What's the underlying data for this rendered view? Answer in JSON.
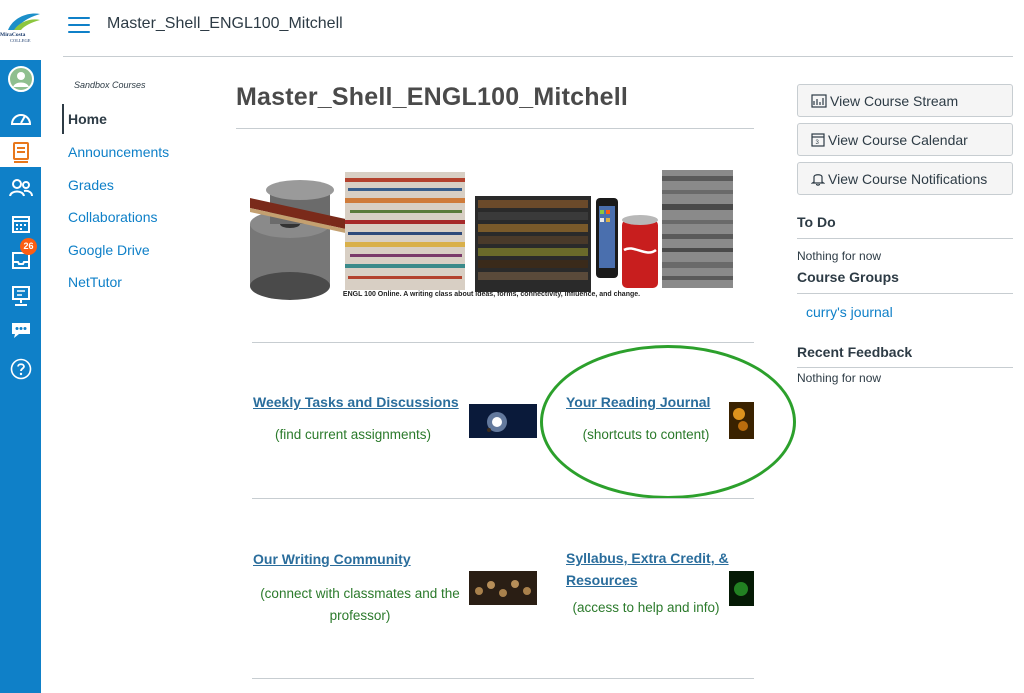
{
  "header": {
    "course_title": "Master_Shell_ENGL100_Mitchell",
    "logo_text": "MiraCosta College"
  },
  "global_nav": {
    "items": [
      {
        "icon": "account-avatar-icon"
      },
      {
        "icon": "dashboard-icon"
      },
      {
        "icon": "courses-icon"
      },
      {
        "icon": "groups-icon"
      },
      {
        "icon": "calendar-icon"
      },
      {
        "icon": "inbox-icon",
        "badge": "26"
      },
      {
        "icon": "studio-icon"
      },
      {
        "icon": "chat-icon"
      },
      {
        "icon": "help-icon"
      }
    ],
    "accent_color": "#0f80c8",
    "badge_color": "#fc5e13"
  },
  "course_nav": {
    "term_label": "Sandbox Courses",
    "items": [
      {
        "label": "Home",
        "active": true
      },
      {
        "label": "Announcements"
      },
      {
        "label": "Grades"
      },
      {
        "label": "Collaborations"
      },
      {
        "label": "Google Drive"
      },
      {
        "label": "NetTutor"
      }
    ]
  },
  "main": {
    "page_title": "Master_Shell_ENGL100_Mitchell",
    "banner_caption": "ENGL 100 Online. A writing class about ideas, forms, connectivity, influence, and change.",
    "sections": [
      {
        "link": "Weekly Tasks and Discussions",
        "subtitle": "(find current assignments)"
      },
      {
        "link": "Your Reading Journal",
        "subtitle": "(shortcuts to content)"
      },
      {
        "link": "Our Writing Community",
        "subtitle": "(connect with classmates and the professor)"
      },
      {
        "link": "Syllabus, Extra Credit, & Resources",
        "subtitle": "(access to help and info)"
      }
    ],
    "highlight_color": "#2ca02c"
  },
  "sidebar": {
    "buttons": [
      {
        "label": "View Course Stream",
        "icon": "stream-icon"
      },
      {
        "label": "View Course Calendar",
        "icon": "calendar-icon"
      },
      {
        "label": "View Course Notifications",
        "icon": "bell-icon"
      }
    ],
    "todo": {
      "heading": "To Do",
      "empty": "Nothing for now"
    },
    "groups": {
      "heading": "Course Groups",
      "items": [
        "curry's journal"
      ]
    },
    "feedback": {
      "heading": "Recent Feedback",
      "empty": "Nothing for now"
    }
  }
}
